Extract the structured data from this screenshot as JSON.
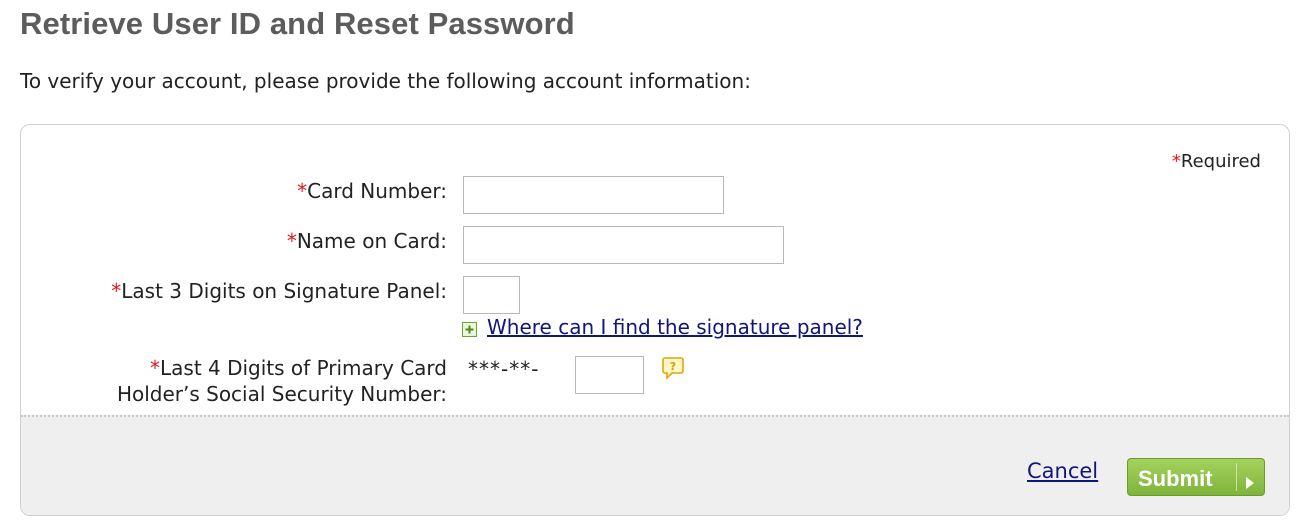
{
  "header": {
    "title": "Retrieve User ID and Reset Password",
    "intro": "To verify your account, please provide the following account information:"
  },
  "form": {
    "required_marker": "*",
    "required_note": "Required",
    "fields": {
      "card_number": {
        "label": "Card Number:",
        "value": ""
      },
      "name_on_card": {
        "label": "Name on Card:",
        "value": ""
      },
      "signature_digits": {
        "label": "Last 3 Digits on Signature Panel:",
        "value": ""
      },
      "ssn_last4": {
        "label_line1": "Last 4 Digits of Primary Card",
        "label_line2": "Holder’s Social Security Number:",
        "mask": "***-**-",
        "value": ""
      }
    },
    "help_link": "Where can I find the signature panel?"
  },
  "actions": {
    "cancel_label": "Cancel",
    "submit_label": "Submit"
  },
  "colors": {
    "title": "#5c5c5c",
    "required_star": "#e5141b",
    "link": "#10177a",
    "submit_button": "#8cc34a",
    "footer_bg": "#efefef"
  },
  "icons": {
    "help_expand": "plus-icon",
    "ssn_help": "question-bubble-icon",
    "submit_arrow": "arrow-right-icon"
  }
}
